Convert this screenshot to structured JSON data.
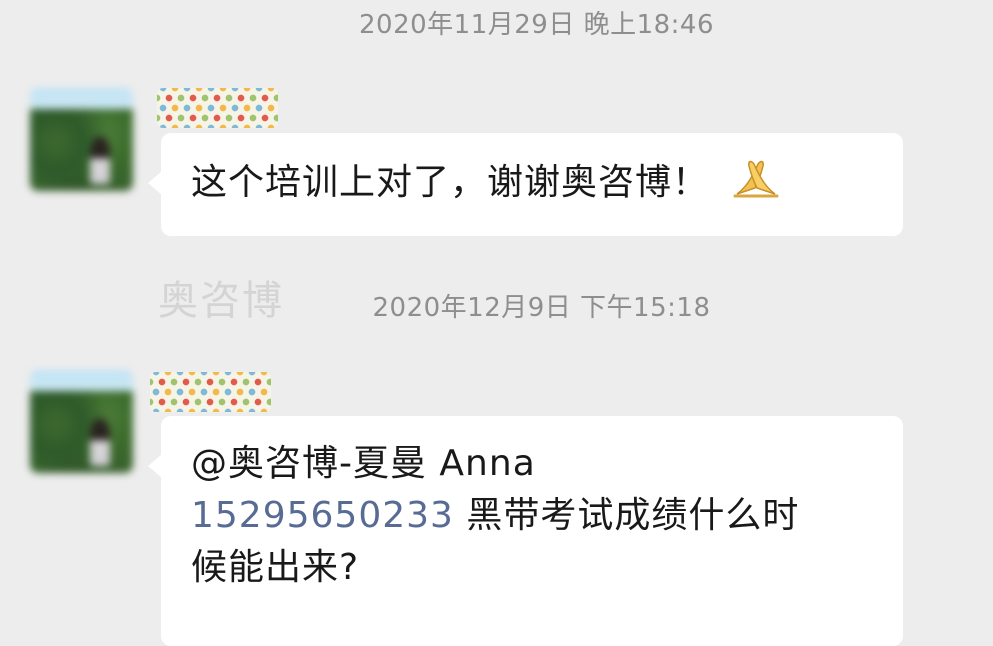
{
  "messages": [
    {
      "timestamp": "2020年11月29日 晚上18:46",
      "text": "这个培训上对了，谢谢奥咨博！",
      "emoji": "folded-hands-emoji"
    },
    {
      "timestamp": "2020年12月9日 下午15:18",
      "mention": "@奥咨博-夏曼 Anna",
      "phone": "15295650233",
      "text_after_phone": " 黑带考试成绩什么时",
      "text_line3": "候能出来?"
    }
  ],
  "watermark": "奥咨博",
  "colors": {
    "background": "#ededed",
    "bubble": "#ffffff",
    "link": "#576b95",
    "timestamp": "#8e8e8e"
  }
}
